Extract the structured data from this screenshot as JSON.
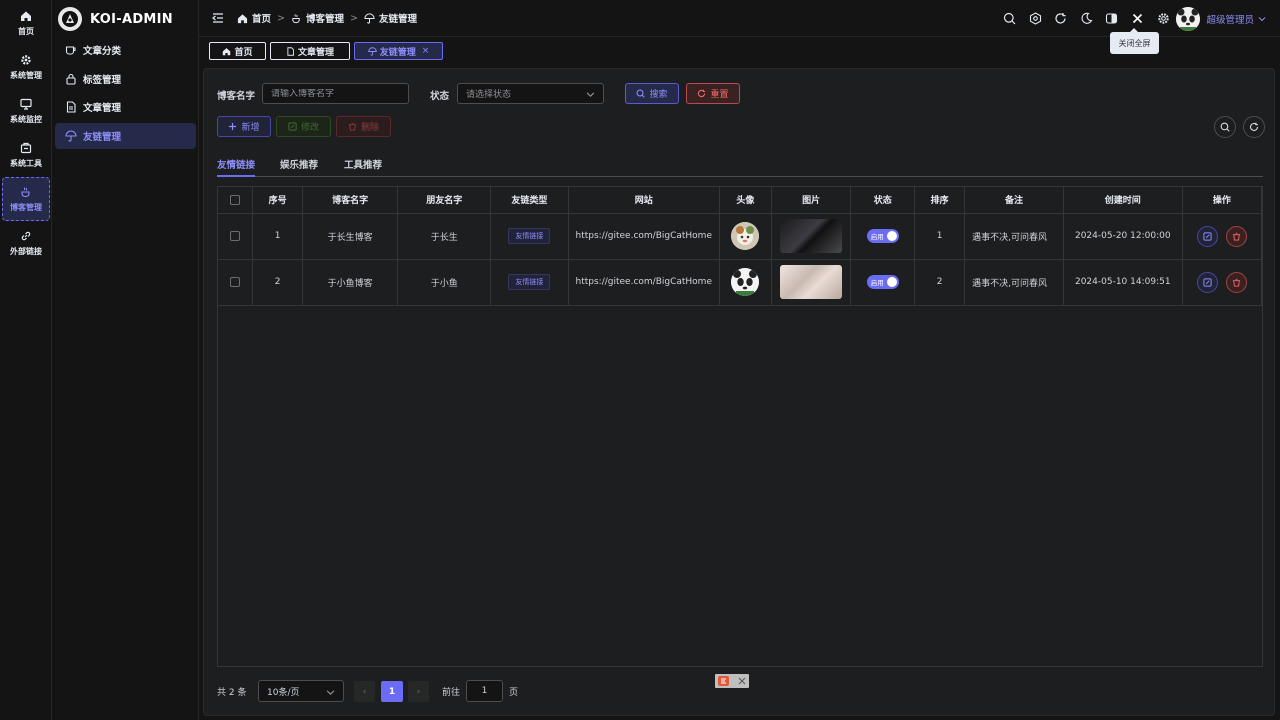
{
  "rail": {
    "items": [
      {
        "label": "首页",
        "icon": "home-icon"
      },
      {
        "label": "系统管理",
        "icon": "gear-icon"
      },
      {
        "label": "系统监控",
        "icon": "monitor-icon"
      },
      {
        "label": "系统工具",
        "icon": "toolbox-icon"
      },
      {
        "label": "博客管理",
        "icon": "coffee-icon",
        "active": true
      },
      {
        "label": "外部链接",
        "icon": "link-icon"
      }
    ]
  },
  "brand": {
    "name": "KOI-ADMIN"
  },
  "submenu": {
    "items": [
      {
        "label": "文章分类",
        "icon": "cup-icon"
      },
      {
        "label": "标签管理",
        "icon": "lock-icon"
      },
      {
        "label": "文章管理",
        "icon": "document-icon"
      },
      {
        "label": "友链管理",
        "icon": "umbrella-icon",
        "active": true
      }
    ]
  },
  "breadcrumb": {
    "items": [
      {
        "label": "首页",
        "icon": "home-icon"
      },
      {
        "label": "博客管理",
        "icon": "coffee-icon"
      },
      {
        "label": "友链管理",
        "icon": "umbrella-icon"
      }
    ]
  },
  "header": {
    "tools": [
      "search-icon",
      "theme-icon",
      "refresh-icon",
      "moon-icon",
      "layout-icon",
      "close-icon",
      "settings-icon"
    ],
    "user_name": "超级管理员",
    "tooltip": "关闭全屏"
  },
  "tabs": [
    {
      "label": "首页",
      "icon": "home-icon"
    },
    {
      "label": "文章管理",
      "icon": "document-icon"
    },
    {
      "label": "友链管理",
      "icon": "umbrella-icon",
      "active": true
    }
  ],
  "filters": {
    "blog_name_label": "博客名字",
    "blog_name_placeholder": "请输入博客名字",
    "status_label": "状态",
    "status_placeholder": "请选择状态",
    "search_label": "搜索",
    "reset_label": "重置"
  },
  "actions": {
    "add": "新增",
    "edit": "修改",
    "delete": "删除"
  },
  "link_tabs": [
    {
      "label": "友情链接",
      "active": true
    },
    {
      "label": "娱乐推荐"
    },
    {
      "label": "工具推荐"
    }
  ],
  "table": {
    "columns": [
      "序号",
      "博客名字",
      "朋友名字",
      "友链类型",
      "网站",
      "头像",
      "图片",
      "状态",
      "排序",
      "备注",
      "创建时间",
      "操作"
    ],
    "rows": [
      {
        "index": "1",
        "blog_name": "于长生博客",
        "friend_name": "于长生",
        "type": "友情链接",
        "site": "https://gitee.com/BigCatHome",
        "status": "启用",
        "sort": "1",
        "remark": "遇事不决,可问春风",
        "created": "2024-05-20 12:00:00",
        "image_color": "#2a2a2e"
      },
      {
        "index": "2",
        "blog_name": "于小鱼博客",
        "friend_name": "于小鱼",
        "type": "友情链接",
        "site": "https://gitee.com/BigCatHome",
        "status": "启用",
        "sort": "2",
        "remark": "遇事不决,可问春风",
        "created": "2024-05-10 14:09:51",
        "image_color": "#d9cfc9"
      }
    ]
  },
  "pagination": {
    "total": "共 2 条",
    "page_size": "10条/页",
    "current": "1",
    "goto_label": "前往",
    "goto_value": "1",
    "page_unit": "页"
  },
  "colors": {
    "accent": "#6b6cf5",
    "danger": "#f56c6c",
    "bg": "#141414",
    "panel": "#1d1e1f"
  }
}
